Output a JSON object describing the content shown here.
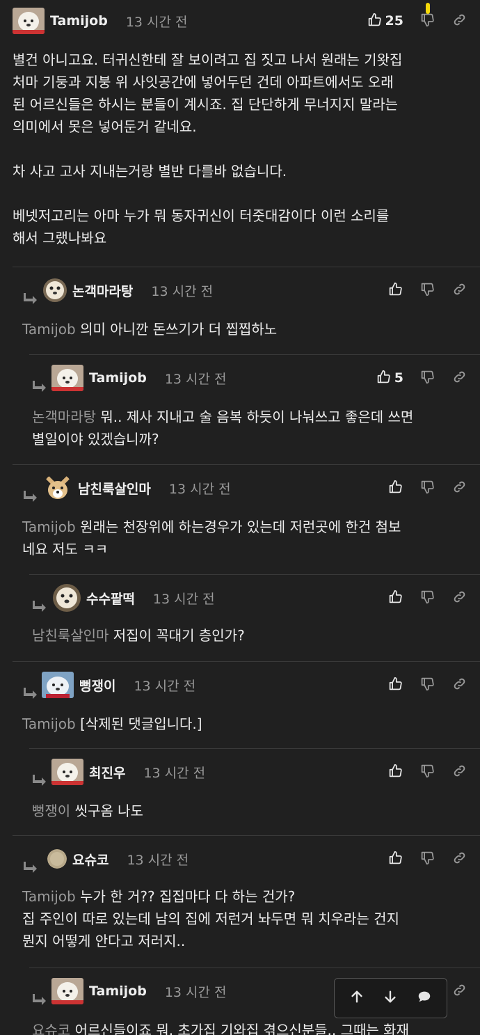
{
  "top_comment": {
    "author": "Tamijob",
    "time": "13 시간 전",
    "likes": "25",
    "paragraphs": [
      "별건 아니고요. 터귀신한테 잘 보이려고 집 짓고 나서 원래는 기왓집\n처마 기둥과 지붕 위 사잇공간에 넣어두던 건데 아파트에서도 오래\n된 어르신들은 하시는 분들이 계시죠. 집 단단하게 무너지지 말라는\n의미에서 못은 넣어둔거 같네요.",
      "차 사고 고사 지내는거랑 별반 다를바 없습니다.",
      "베넷저고리는 아마 누가 뭐 동자귀신이 터줏대감이다 이런 소리를\n해서 그랬나봐요"
    ]
  },
  "replies": [
    {
      "author": "논객마라탕",
      "time": "13 시간 전",
      "likes": "",
      "mention": "Tamijob",
      "text": "의미 아니깐 돈쓰기가 더 찝찝하노"
    },
    {
      "author": "Tamijob",
      "time": "13 시간 전",
      "likes": "5",
      "mention": "논객마라탕",
      "text": "뭐.. 제사 지내고 술 음복 하듯이 나눠쓰고 좋은데 쓰면\n별일이야 있겠습니까?"
    },
    {
      "author": "남친룩살인마",
      "time": "13 시간 전",
      "likes": "",
      "mention": "Tamijob",
      "text": "원래는 천장위에 하는경우가 있는데 저런곳에 한건 첨보\n네요 저도 ㅋㅋ"
    },
    {
      "author": "수수팥떡",
      "time": "13 시간 전",
      "likes": "",
      "mention": "남친룩살인마",
      "text": "저집이 꼭대기 층인가?"
    },
    {
      "author": "뻥쟁이",
      "time": "13 시간 전",
      "likes": "",
      "mention": "Tamijob",
      "text": "[삭제된 댓글입니다.]"
    },
    {
      "author": "최진우",
      "time": "13 시간 전",
      "likes": "",
      "mention": "뻥쟁이",
      "text": "씻구옴 나도"
    },
    {
      "author": "요슈코",
      "time": "13 시간 전",
      "likes": "",
      "mention": "Tamijob",
      "text": "누가 한 거?? 집집마다 다 하는 건가?\n집 주인이 따로 있는데 남의 집에 저런거 놔두면 뭐 치우라는 건지\n뭔지 어떻게 안다고 저러지.."
    },
    {
      "author": "Tamijob",
      "time": "13 시간 전",
      "likes": "",
      "mention": "요슈코",
      "text": "어르신들이죠 뭐. 초가집 기와집 겪으신분들.. 그때는 화재"
    }
  ],
  "icons": {
    "like": "thumbs-up-icon",
    "dislike": "thumbs-down-icon",
    "link": "link-icon",
    "reply": "reply-arrow-icon",
    "up": "arrow-up-icon",
    "down": "arrow-down-icon",
    "chat": "chat-bubble-icon"
  },
  "colors": {
    "background": "#202020",
    "text": "#ececec",
    "muted": "#9a9a9a",
    "separator": "#3a3a3a",
    "highlight": "#f5d90a"
  }
}
